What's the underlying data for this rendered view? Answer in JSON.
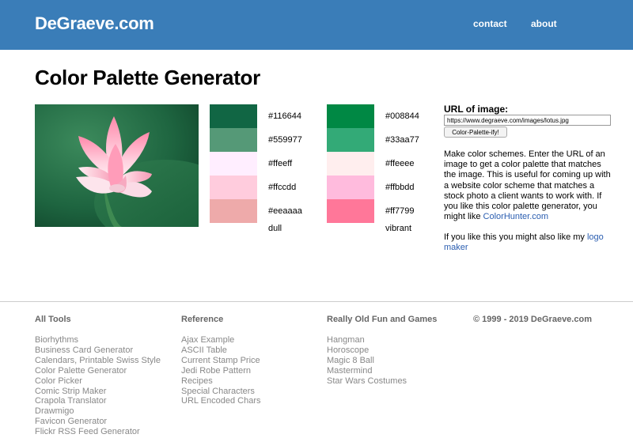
{
  "header": {
    "logo": "DeGraeve.com",
    "nav": {
      "contact": "contact",
      "about": "about"
    },
    "background_color": "#3a7db8"
  },
  "page_title": "Color Palette Generator",
  "palettes": {
    "dull": {
      "label": "dull",
      "colors": [
        {
          "hex": "#116644",
          "color": "#116644"
        },
        {
          "hex": "#559977",
          "color": "#559977"
        },
        {
          "hex": "#ffeeff",
          "color": "#ffeeff"
        },
        {
          "hex": "#ffccdd",
          "color": "#ffccdd"
        },
        {
          "hex": "#eeaaaa",
          "color": "#eeaaaa"
        }
      ]
    },
    "vibrant": {
      "label": "vibrant",
      "colors": [
        {
          "hex": "#008844",
          "color": "#008844"
        },
        {
          "hex": "#33aa77",
          "color": "#33aa77"
        },
        {
          "hex": "#ffeeee",
          "color": "#ffeeee"
        },
        {
          "hex": "#ffbbdd",
          "color": "#ffbbdd"
        },
        {
          "hex": "#ff7799",
          "color": "#ff7799"
        }
      ]
    }
  },
  "form": {
    "label": "URL of image:",
    "url_value": "https://www.degraeve.com/images/lotus.jpg",
    "button_label": "Color-Palette-ify!"
  },
  "description": {
    "text": "Make color schemes. Enter the URL of an image to get a color palette that matches the image. This is useful for coming up with a website color scheme that matches a stock photo a client wants to work with. If you like this color palette generator, you might like ",
    "link": "ColorHunter.com",
    "text2": "If you like this you might also like my ",
    "link2": "logo maker"
  },
  "footer": {
    "all_tools": {
      "heading": "All Tools",
      "items": [
        "Biorhythms",
        "Business Card Generator",
        "Calendars, Printable Swiss Style",
        "Color Palette Generator",
        "Color Picker",
        "Comic Strip Maker",
        "Crapola Translator",
        "Drawmigo",
        "Favicon Generator",
        "Flickr RSS Feed Generator"
      ]
    },
    "reference": {
      "heading": "Reference",
      "items": [
        "Ajax Example",
        "ASCII Table",
        "Current Stamp Price",
        "Jedi Robe Pattern",
        "Recipes",
        "Special Characters",
        "URL Encoded Chars"
      ]
    },
    "games": {
      "heading": "Really Old Fun and Games",
      "items": [
        "Hangman",
        "Horoscope",
        "Magic 8 Ball",
        "Mastermind",
        "Star Wars Costumes"
      ]
    },
    "copyright": "© 1999 - 2019 DeGraeve.com"
  }
}
